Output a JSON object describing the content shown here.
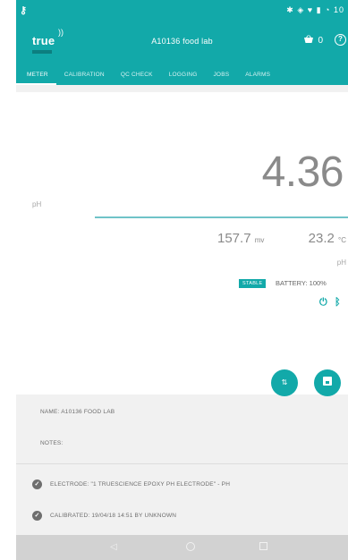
{
  "status_bar": {
    "left_icon": "usb-key-icon",
    "right_text": "✱ ◈ ♥ ▮ ◔ 10"
  },
  "app_bar": {
    "logo_text": "true",
    "title": "A10136 food lab",
    "cart_count": "0",
    "help_icon": "?"
  },
  "tabs": [
    {
      "label": "METER",
      "active": true
    },
    {
      "label": "CALIBRATION",
      "active": false
    },
    {
      "label": "QC CHECK",
      "active": false
    },
    {
      "label": "LOGGING",
      "active": false
    },
    {
      "label": "JOBS",
      "active": false
    },
    {
      "label": "ALARMS",
      "active": false
    }
  ],
  "meter": {
    "unit_left": "pH",
    "reading": "4.36",
    "mv_value": "157.7",
    "mv_unit": "mv",
    "temp_value": "23.2",
    "temp_unit": "°C",
    "unit_right": "pH",
    "stable_badge": "STABLE",
    "battery": "BATTERY: 100%",
    "swap_icon": "⇅"
  },
  "info": {
    "name": "NAME: A10136 FOOD LAB",
    "notes": "NOTES:",
    "electrode": "ELECTRODE: \"1 TRUESCIENCE EPOXY PH ELECTRODE\" - PH",
    "calibrated": "CALIBRATED: 19/04/18 14:51 BY UNKNOWN",
    "check_glyph": "✓"
  },
  "nav": {
    "back": "◁"
  },
  "colors": {
    "accent": "#12a9a9",
    "background": "#f1f1f1",
    "card": "#ffffff"
  }
}
